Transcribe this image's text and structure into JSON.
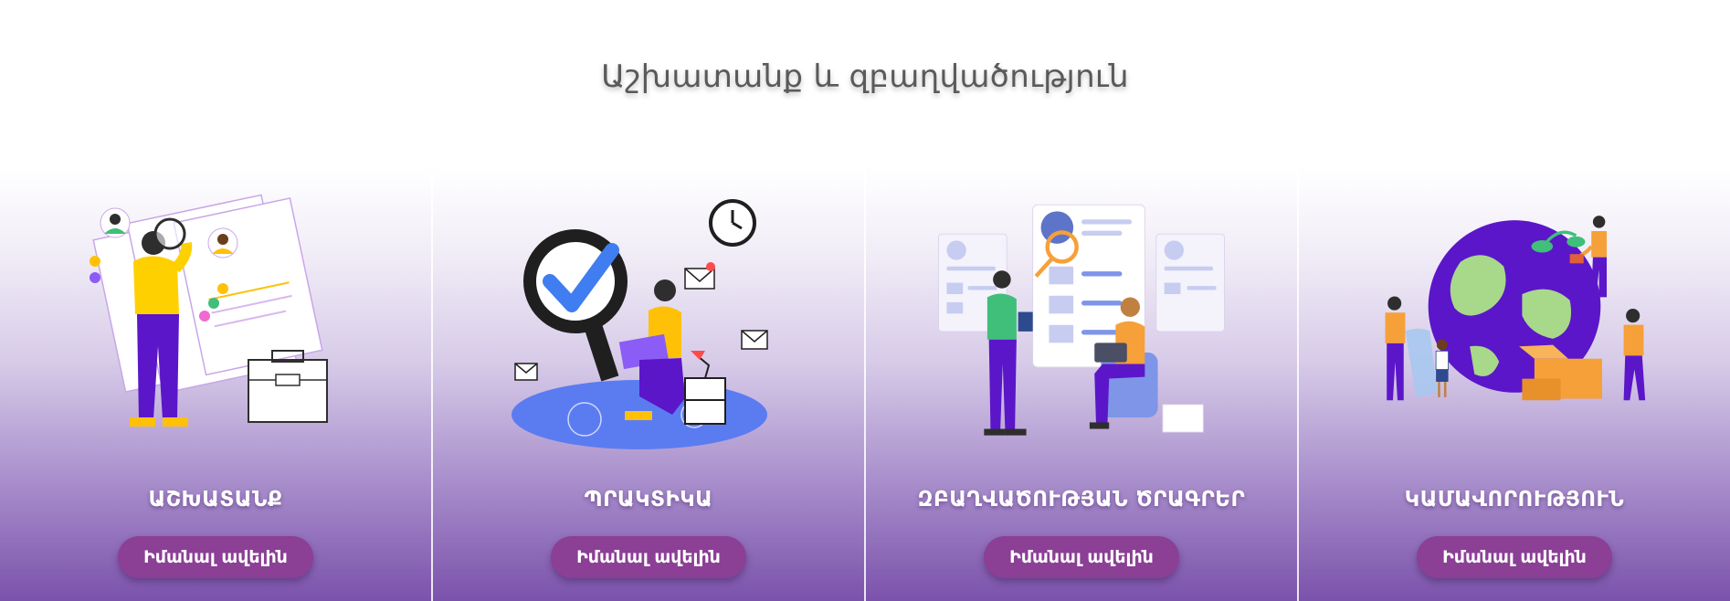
{
  "section": {
    "title": "Աշխատանք և զբաղվածություն"
  },
  "cards": [
    {
      "title": "ԱՇԽԱՏԱՆՔ",
      "button_label": "Իմանալ ավելին",
      "illustration": "job-search-illustration"
    },
    {
      "title": "ՊՐԱԿՏԻԿԱ",
      "button_label": "Իմանալ ավելին",
      "illustration": "internship-illustration"
    },
    {
      "title": "ԶԲԱՂՎԱԾՈՒԹՅԱՆ ԾՐԱԳՐԵՐ",
      "button_label": "Իմանալ ավելին",
      "illustration": "employment-programs-illustration"
    },
    {
      "title": "ԿԱՄԱՎՈՐՈՒԹՅՈՒՆ",
      "button_label": "Իմանալ ավելին",
      "illustration": "volunteering-illustration"
    }
  ],
  "colors": {
    "button": "#8b3f95",
    "gradient_bottom": "#7b52ab",
    "accent_purple": "#5b16c9",
    "accent_yellow": "#ffc107",
    "accent_orange": "#f6a03a"
  }
}
